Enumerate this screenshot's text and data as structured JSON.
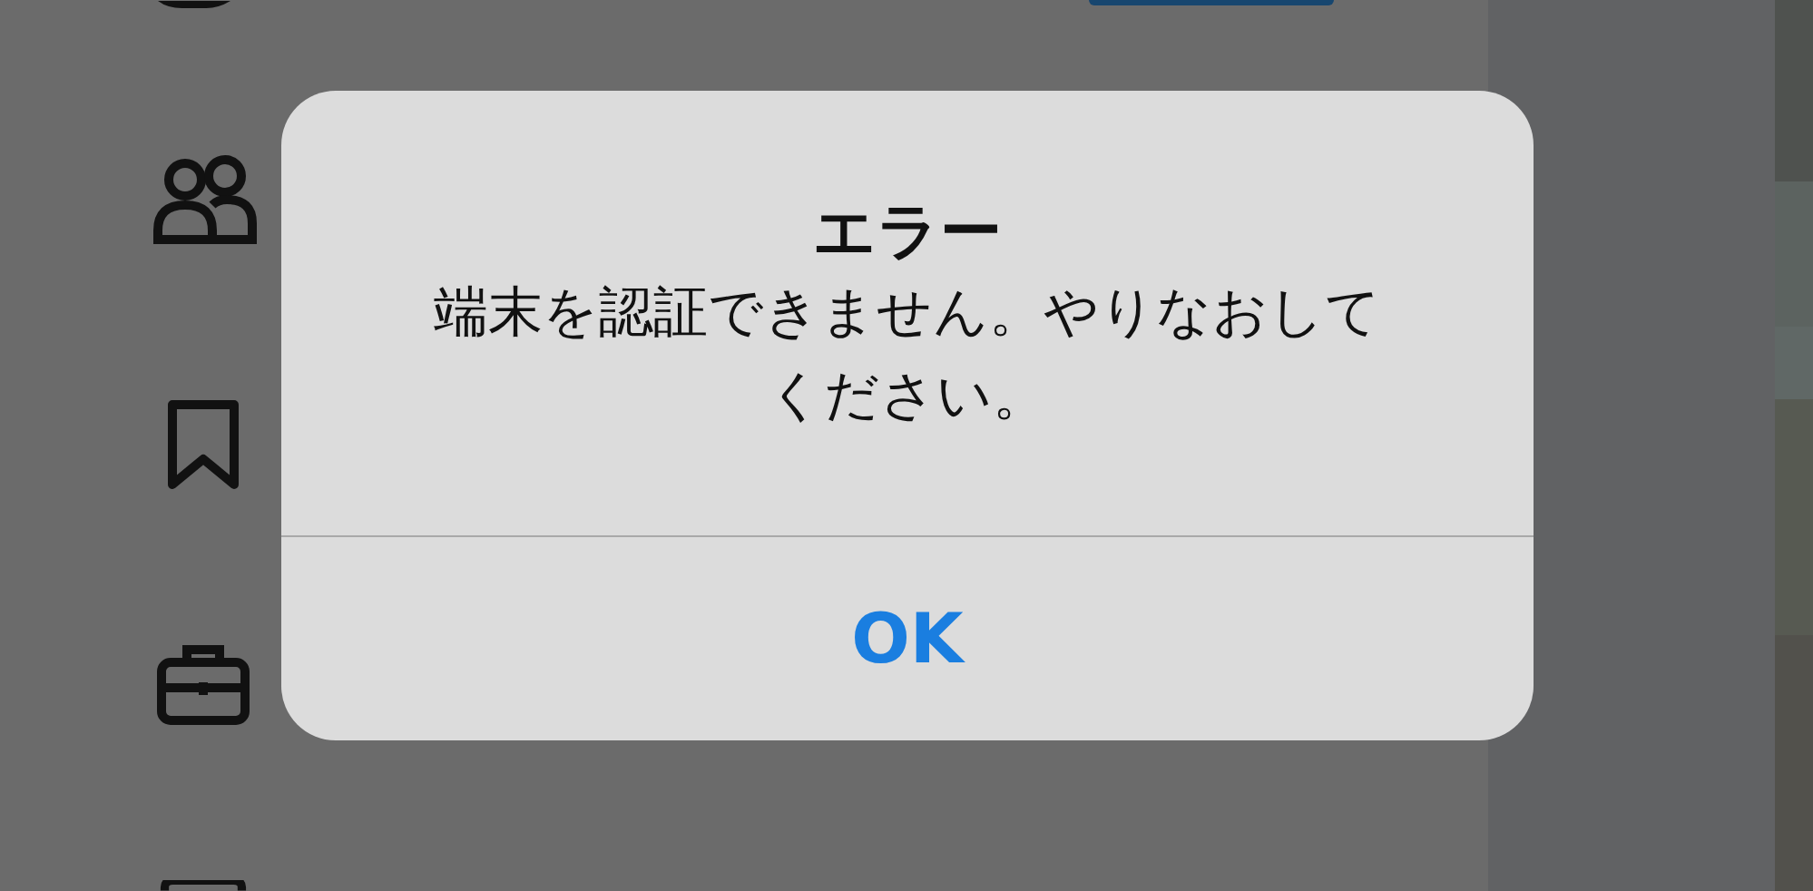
{
  "alert": {
    "title": "エラー",
    "message": "端末を認証できません。やりなおしてください。",
    "buttons": [
      {
        "label": "OK"
      }
    ]
  }
}
